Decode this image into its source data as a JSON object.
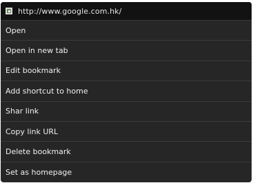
{
  "header": {
    "favicon_icon": "site-favicon-icon",
    "url": "http://www.google.com.hk/"
  },
  "menu": {
    "items": [
      {
        "label": "Open"
      },
      {
        "label": "Open in new tab"
      },
      {
        "label": "Edit bookmark"
      },
      {
        "label": "Add shortcut to home"
      },
      {
        "label": "Shar link"
      },
      {
        "label": "Copy link URL"
      },
      {
        "label": "Delete bookmark"
      },
      {
        "label": "Set as homepage"
      }
    ]
  },
  "colors": {
    "panel_background": "#262626",
    "header_background": "#121212",
    "divider": "#3b3b3b",
    "text": "#f0f0f0"
  }
}
